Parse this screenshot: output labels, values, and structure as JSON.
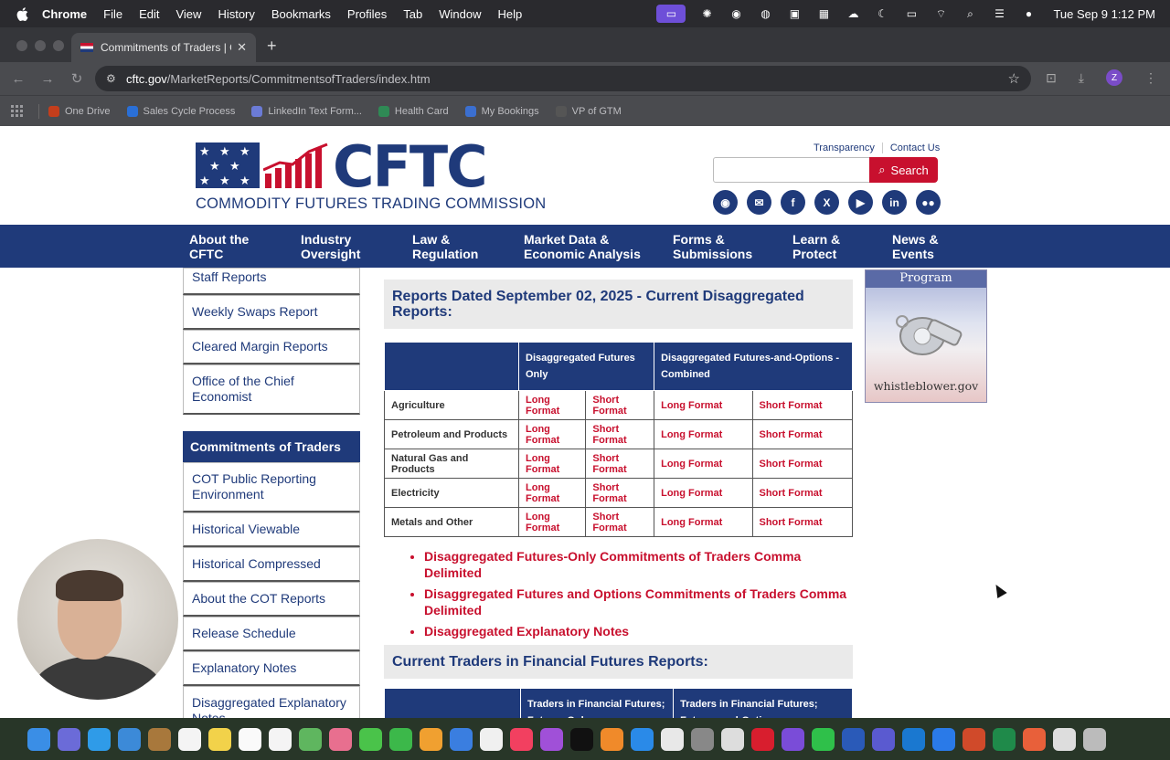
{
  "menubar": {
    "app": "Chrome",
    "items": [
      "File",
      "Edit",
      "View",
      "History",
      "Bookmarks",
      "Profiles",
      "Tab",
      "Window",
      "Help"
    ],
    "clock": "Tue Sep 9  1:12 PM"
  },
  "browser": {
    "tab_title": "Commitments of Traders | CF",
    "tab_close": "✕",
    "new_tab": "+",
    "url_host": "cftc.gov",
    "url_path": "/MarketReports/CommitmentsofTraders/index.htm",
    "profile_initial": "Z",
    "bookmarks": [
      "One Drive",
      "Sales Cycle Process",
      "LinkedIn Text Form...",
      "Health Card",
      "My Bookings",
      "VP of GTM"
    ]
  },
  "header": {
    "logo_word": "CFTC",
    "logo_sub": "COMMODITY FUTURES TRADING COMMISSION",
    "transparency": "Transparency",
    "contact": "Contact Us",
    "search_value": "",
    "search_label": "Search"
  },
  "nav": [
    {
      "l1": "About the",
      "l2": "CFTC"
    },
    {
      "l1": "Industry",
      "l2": "Oversight"
    },
    {
      "l1": "Law &",
      "l2": "Regulation"
    },
    {
      "l1": "Market Data &",
      "l2": "Economic Analysis"
    },
    {
      "l1": "Forms &",
      "l2": "Submissions"
    },
    {
      "l1": "Learn &",
      "l2": "Protect"
    },
    {
      "l1": "News &",
      "l2": "Events"
    }
  ],
  "sidebar": {
    "top_items": [
      "Staff Reports",
      "Weekly Swaps Report",
      "Cleared Margin Reports",
      "Office of the Chief Economist"
    ],
    "cot_heading": "Commitments of Traders",
    "cot_items": [
      "COT Public Reporting Environment",
      "Historical Viewable",
      "Historical Compressed",
      "About the COT Reports",
      "Release Schedule",
      "Explanatory Notes",
      "Disaggregated Explanatory Notes"
    ]
  },
  "main": {
    "section1_title": "Reports Dated September 02, 2025 - Current Disaggregated Reports:",
    "col_futures": "Disaggregated Futures Only",
    "col_combined": "Disaggregated Futures-and-Options -Combined",
    "long": "Long Format",
    "short": "Short Format",
    "rows": [
      "Agriculture",
      "Petroleum and Products",
      "Natural Gas and Products",
      "Electricity",
      "Metals and Other"
    ],
    "links": [
      "Disaggregated Futures-Only Commitments of Traders Comma Delimited",
      "Disaggregated Futures and Options Commitments of Traders Comma Delimited",
      "Disaggregated Explanatory Notes"
    ],
    "section2_title": "Current Traders in Financial Futures Reports:",
    "col2_futures": "Traders in Financial Futures; Futures Only",
    "col2_combined": "Traders in Financial Futures; Futures-and-Options -"
  },
  "ad": {
    "program": "Program",
    "url": "whistleblower.gov"
  },
  "colors": {
    "navy": "#1f3a7a",
    "red": "#c8102e"
  }
}
